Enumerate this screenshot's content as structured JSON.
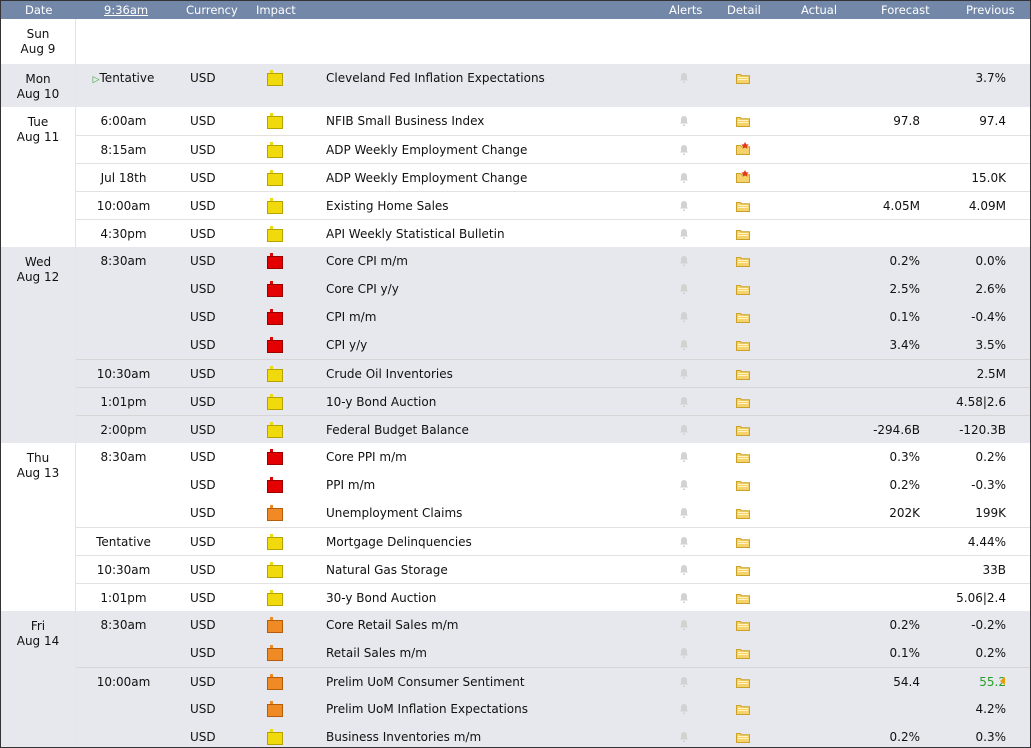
{
  "header": {
    "date": "Date",
    "time": "9:36am",
    "currency": "Currency",
    "impact": "Impact",
    "alerts": "Alerts",
    "detail": "Detail",
    "actual": "Actual",
    "forecast": "Forecast",
    "previous": "Previous"
  },
  "colors": {
    "header_bg": "#7388a9",
    "shade_bg": "#e7e8ed",
    "impact_yellow": "#f1da0b",
    "impact_red": "#e40000",
    "impact_orange": "#ef8a25",
    "better_green": "#2aa02a"
  },
  "days": [
    {
      "weekday": "Sun",
      "date": "Aug 9",
      "rows": []
    },
    {
      "weekday": "Mon",
      "date": "Aug 10",
      "rows": [
        {
          "time": "Tentative",
          "currency": "USD",
          "impact": "yellow",
          "title": "Cleveland Fed Inflation Expectations",
          "forecast": "",
          "previous": "3.7%",
          "detail_icon": "folder-icon"
        }
      ]
    },
    {
      "weekday": "Tue",
      "date": "Aug 11",
      "rows": [
        {
          "time": "6:00am",
          "currency": "USD",
          "impact": "yellow",
          "title": "NFIB Small Business Index",
          "forecast": "97.8",
          "previous": "97.4",
          "detail_icon": "folder-icon"
        },
        {
          "time": "8:15am",
          "currency": "USD",
          "impact": "yellow",
          "title": "ADP Weekly Employment Change",
          "forecast": "",
          "previous": "",
          "detail_icon": "new-folder-icon"
        },
        {
          "time": "Jul 18th",
          "currency": "USD",
          "impact": "yellow",
          "title": "ADP Weekly Employment Change",
          "forecast": "",
          "previous": "15.0K",
          "detail_icon": "new-folder-icon"
        },
        {
          "time": "10:00am",
          "currency": "USD",
          "impact": "yellow",
          "title": "Existing Home Sales",
          "forecast": "4.05M",
          "previous": "4.09M",
          "detail_icon": "folder-icon"
        },
        {
          "time": "4:30pm",
          "currency": "USD",
          "impact": "yellow",
          "title": "API Weekly Statistical Bulletin",
          "forecast": "",
          "previous": "",
          "detail_icon": "folder-icon"
        }
      ]
    },
    {
      "weekday": "Wed",
      "date": "Aug 12",
      "rows": [
        {
          "time": "8:30am",
          "currency": "USD",
          "impact": "red",
          "title": "Core CPI m/m",
          "forecast": "0.2%",
          "previous": "0.0%",
          "detail_icon": "folder-icon"
        },
        {
          "time": "",
          "currency": "USD",
          "impact": "red",
          "title": "Core CPI y/y",
          "forecast": "2.5%",
          "previous": "2.6%",
          "detail_icon": "folder-icon"
        },
        {
          "time": "",
          "currency": "USD",
          "impact": "red",
          "title": "CPI m/m",
          "forecast": "0.1%",
          "previous": "-0.4%",
          "detail_icon": "folder-icon"
        },
        {
          "time": "",
          "currency": "USD",
          "impact": "red",
          "title": "CPI y/y",
          "forecast": "3.4%",
          "previous": "3.5%",
          "detail_icon": "folder-icon"
        },
        {
          "time": "10:30am",
          "currency": "USD",
          "impact": "yellow",
          "title": "Crude Oil Inventories",
          "forecast": "",
          "previous": "2.5M",
          "detail_icon": "folder-icon"
        },
        {
          "time": "1:01pm",
          "currency": "USD",
          "impact": "yellow",
          "title": "10-y Bond Auction",
          "forecast": "",
          "previous": "4.58|2.6",
          "detail_icon": "folder-icon"
        },
        {
          "time": "2:00pm",
          "currency": "USD",
          "impact": "yellow",
          "title": "Federal Budget Balance",
          "forecast": "-294.6B",
          "previous": "-120.3B",
          "detail_icon": "folder-icon"
        }
      ]
    },
    {
      "weekday": "Thu",
      "date": "Aug 13",
      "rows": [
        {
          "time": "8:30am",
          "currency": "USD",
          "impact": "red",
          "title": "Core PPI m/m",
          "forecast": "0.3%",
          "previous": "0.2%",
          "detail_icon": "folder-icon"
        },
        {
          "time": "",
          "currency": "USD",
          "impact": "red",
          "title": "PPI m/m",
          "forecast": "0.2%",
          "previous": "-0.3%",
          "detail_icon": "folder-icon"
        },
        {
          "time": "",
          "currency": "USD",
          "impact": "orange",
          "title": "Unemployment Claims",
          "forecast": "202K",
          "previous": "199K",
          "detail_icon": "folder-icon"
        },
        {
          "time": "Tentative",
          "currency": "USD",
          "impact": "yellow",
          "title": "Mortgage Delinquencies",
          "forecast": "",
          "previous": "4.44%",
          "detail_icon": "folder-icon"
        },
        {
          "time": "10:30am",
          "currency": "USD",
          "impact": "yellow",
          "title": "Natural Gas Storage",
          "forecast": "",
          "previous": "33B",
          "detail_icon": "folder-icon"
        },
        {
          "time": "1:01pm",
          "currency": "USD",
          "impact": "yellow",
          "title": "30-y Bond Auction",
          "forecast": "",
          "previous": "5.06|2.4",
          "detail_icon": "folder-icon"
        }
      ]
    },
    {
      "weekday": "Fri",
      "date": "Aug 14",
      "rows": [
        {
          "time": "8:30am",
          "currency": "USD",
          "impact": "orange",
          "title": "Core Retail Sales m/m",
          "forecast": "0.2%",
          "previous": "-0.2%",
          "detail_icon": "folder-icon"
        },
        {
          "time": "",
          "currency": "USD",
          "impact": "orange",
          "title": "Retail Sales m/m",
          "forecast": "0.1%",
          "previous": "0.2%",
          "detail_icon": "folder-icon"
        },
        {
          "time": "10:00am",
          "currency": "USD",
          "impact": "orange",
          "title": "Prelim UoM Consumer Sentiment",
          "forecast": "54.4",
          "previous": "55.2",
          "previous_revised": true,
          "detail_icon": "folder-icon"
        },
        {
          "time": "",
          "currency": "USD",
          "impact": "orange",
          "title": "Prelim UoM Inflation Expectations",
          "forecast": "",
          "previous": "4.2%",
          "detail_icon": "folder-icon"
        },
        {
          "time": "",
          "currency": "USD",
          "impact": "yellow",
          "title": "Business Inventories m/m",
          "forecast": "0.2%",
          "previous": "0.3%",
          "detail_icon": "folder-icon"
        }
      ]
    }
  ]
}
